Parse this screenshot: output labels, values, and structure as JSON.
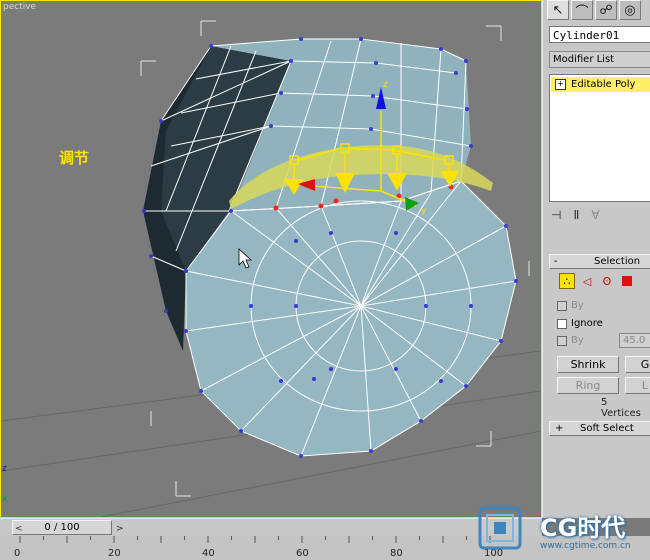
{
  "viewport": {
    "label": "pective",
    "annotation": "调节"
  },
  "command_panel": {
    "tabs": [
      {
        "icon": "select-arrow-icon",
        "glyph": "↖"
      },
      {
        "icon": "curve-icon",
        "glyph": "⌒"
      },
      {
        "icon": "hierarchy-icon",
        "glyph": "☍"
      },
      {
        "icon": "motion-icon",
        "glyph": "◎"
      }
    ],
    "object_name": "Cylinder01",
    "modifier_list": "Modifier List",
    "stack_item": "Editable Poly",
    "selection": {
      "collapse": "-",
      "title": "Selection",
      "by_vertex": "By",
      "ignore_backfacing": "Ignore",
      "by_angle": "By",
      "angle_value": "45.0",
      "shrink_label": "Shrink",
      "grow_label": "G",
      "ring_label": "Ring",
      "loop_label": "L",
      "vertex_count": "5 Vertices"
    },
    "soft_selection": {
      "expand": "+",
      "title": "Soft Select"
    }
  },
  "timeline": {
    "slider_label": "0 / 100",
    "left_arrow": "<",
    "right_arrow": ">",
    "ticks": [
      "0",
      "20",
      "40",
      "60",
      "80",
      "100"
    ]
  },
  "watermark": {
    "title": "CG时代",
    "url": "www.cgtime.com.cn"
  },
  "colors": {
    "mesh_face": "#94b7c2",
    "mesh_dark": "#1a2228",
    "wire": "#ffffff",
    "vertex": "#3a3ad0",
    "selected_vertex": "#ff2020",
    "highlight": "#ffe200",
    "gizmo_x": "#e01010",
    "gizmo_y": "#10a010",
    "gizmo_z": "#1010e0"
  }
}
